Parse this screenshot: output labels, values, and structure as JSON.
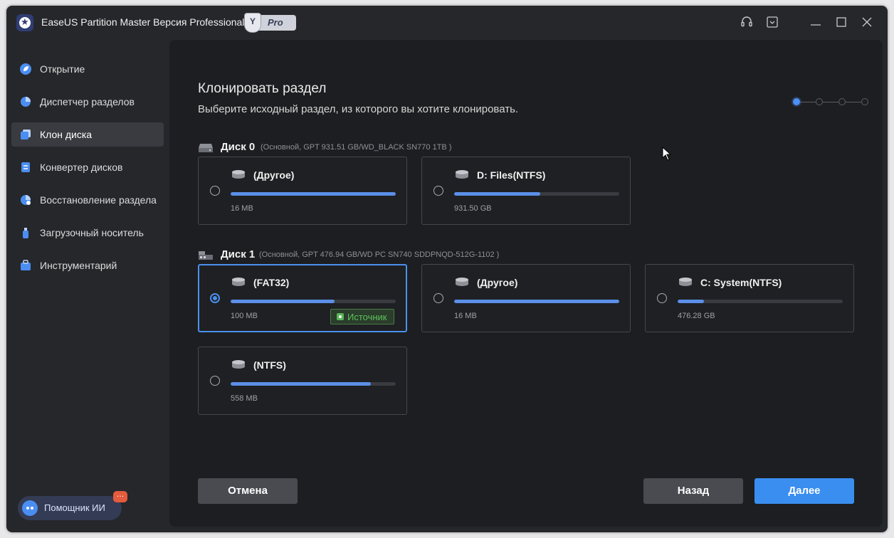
{
  "app": {
    "title": "EaseUS Partition Master Версия Professional",
    "badge_letter": "Y",
    "badge_label": "Pro"
  },
  "sidebar": {
    "items": [
      {
        "label": "Открытие",
        "icon": "leaf-icon"
      },
      {
        "label": "Диспетчер разделов",
        "icon": "pie-icon"
      },
      {
        "label": "Клон диска",
        "icon": "clone-icon",
        "active": true
      },
      {
        "label": "Конвертер дисков",
        "icon": "convert-icon"
      },
      {
        "label": "Восстановление раздела",
        "icon": "recovery-icon"
      },
      {
        "label": "Загрузочный носитель",
        "icon": "usb-icon"
      },
      {
        "label": "Инструментарий",
        "icon": "toolbox-icon"
      }
    ],
    "ai_assistant": "Помощник ИИ",
    "ai_chat_glyph": "…"
  },
  "page": {
    "title": "Клонировать раздел",
    "subtitle": "Выберите исходный раздел, из которого вы хотите клонировать.",
    "current_step": 1,
    "total_steps": 4
  },
  "disks": [
    {
      "name": "Диск 0",
      "info": "(Основной, GPT 931.51 GB/WD_BLACK SN770 1TB )",
      "partitions": [
        {
          "name": "(Другое)",
          "size": "16 MB",
          "usage": 1.0
        },
        {
          "name": "D: Files(NTFS)",
          "size": "931.50 GB",
          "usage": 0.52
        }
      ]
    },
    {
      "name": "Диск 1",
      "info": "(Основной, GPT 476.94 GB/WD PC SN740 SDDPNQD-512G-1102 )",
      "partitions": [
        {
          "name": "(FAT32)",
          "size": "100 MB",
          "usage": 0.63,
          "selected": true,
          "badge": "Источник"
        },
        {
          "name": "(Другое)",
          "size": "16 MB",
          "usage": 1.0
        },
        {
          "name": "C: System(NTFS)",
          "size": "476.28 GB",
          "usage": 0.16
        },
        {
          "name": "(NTFS)",
          "size": "558 MB",
          "usage": 0.85
        }
      ]
    }
  ],
  "buttons": {
    "cancel": "Отмена",
    "back": "Назад",
    "next": "Далее"
  },
  "colors": {
    "accent": "#3a8ef0",
    "usage_bar": "#5b8fe8",
    "source_badge": "#5bc15b",
    "panel": "#1d1e21",
    "window": "#26272b"
  }
}
